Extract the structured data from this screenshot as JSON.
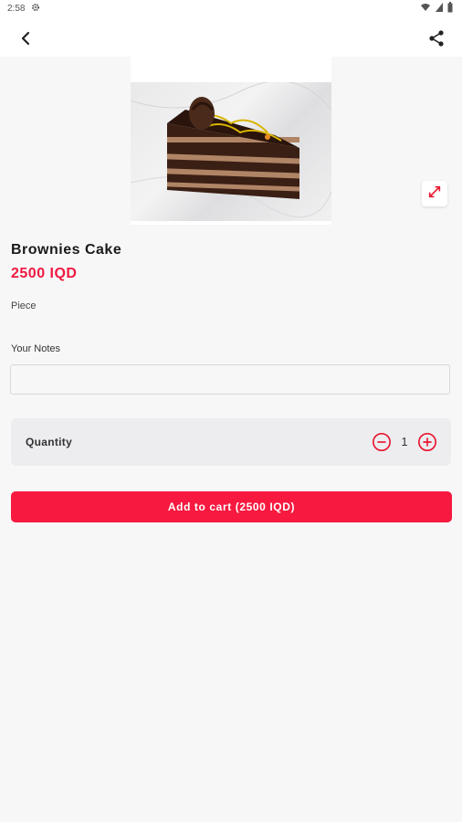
{
  "status_bar": {
    "time": "2:58"
  },
  "product": {
    "name": "Brownies Cake",
    "price": "2500 IQD",
    "unit": "Piece"
  },
  "notes": {
    "label": "Your Notes",
    "value": "",
    "placeholder": ""
  },
  "quantity": {
    "label": "Quantity",
    "value": "1"
  },
  "cart_button": {
    "label": "Add to cart (2500 IQD)"
  },
  "colors": {
    "accent": "#f7193f",
    "price": "#f0183f",
    "background": "#f7f7f8"
  },
  "icons": {
    "back": "back-arrow-icon",
    "share": "share-icon",
    "expand": "expand-icon",
    "minus": "minus-circle-icon",
    "plus": "plus-circle-icon"
  }
}
